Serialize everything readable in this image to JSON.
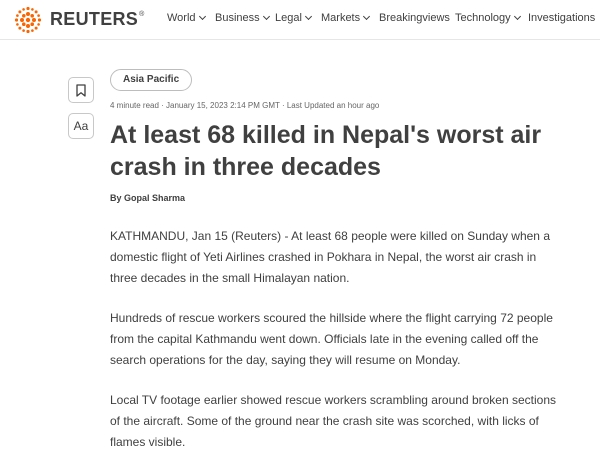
{
  "brand": {
    "name": "REUTERS",
    "reg_mark": "®",
    "accent": "#fa6400"
  },
  "nav": {
    "items": [
      {
        "label": "World",
        "has_dropdown": true
      },
      {
        "label": "Business",
        "has_dropdown": true
      },
      {
        "label": "Legal",
        "has_dropdown": true
      },
      {
        "label": "Markets",
        "has_dropdown": true
      },
      {
        "label": "Breakingviews",
        "has_dropdown": false
      },
      {
        "label": "Technology",
        "has_dropdown": true
      },
      {
        "label": "Investigations",
        "has_dropdown": false
      }
    ]
  },
  "tools": {
    "bookmark_icon": "bookmark-icon",
    "text_size_label": "Aa"
  },
  "article": {
    "section_tag": "Asia Pacific",
    "meta": "4 minute read · January 15, 2023 2:14 PM GMT · Last Updated an hour ago",
    "headline": "At least 68 killed in Nepal's worst air crash in three decades",
    "byline": "By Gopal Sharma",
    "paragraphs": [
      "KATHMANDU, Jan 15 (Reuters) - At least 68 people were killed on Sunday when a domestic flight of Yeti Airlines crashed in Pokhara in Nepal, the worst air crash in three decades in the small Himalayan nation.",
      "Hundreds of rescue workers scoured the hillside where the flight carrying 72 people from the capital Kathmandu went down. Officials late in the evening called off the search operations for the day, saying they will resume on Monday.",
      "Local TV footage earlier showed rescue workers scrambling around broken sections of the aircraft. Some of the ground near the crash site was scorched, with licks of flames visible."
    ]
  }
}
